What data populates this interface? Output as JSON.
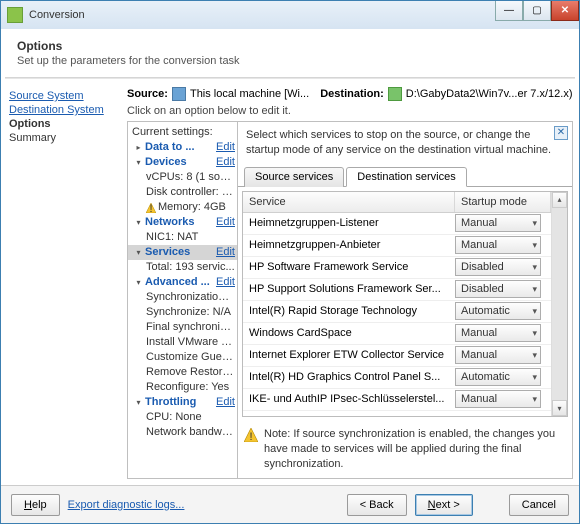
{
  "title": "Conversion",
  "header": {
    "title": "Options",
    "subtitle": "Set up the parameters for the conversion task"
  },
  "nav": {
    "source": "Source System",
    "destination": "Destination System",
    "options": "Options",
    "summary": "Summary"
  },
  "srcline": {
    "source_label": "Source:",
    "source_value": "This local machine [Wi...",
    "dest_label": "Destination:",
    "dest_value": "D:\\GabyData2\\Win7v...er 7.x/12.x)"
  },
  "clickhint": "Click on an option below to edit it.",
  "tree": {
    "title": "Current settings:",
    "edit": "Edit",
    "items": {
      "data": "Data to ...",
      "devices": "Devices",
      "vcpus": "vCPUs: 8 (1 sock...",
      "diskctrl": "Disk controller: S...",
      "memory": "Memory: 4GB",
      "networks": "Networks",
      "nic1": "NIC1: NAT",
      "services": "Services",
      "servtotal": "Total: 193 servic...",
      "advanced": "Advanced ...",
      "sync": "Synchronization: ...",
      "syncna": "Synchronize: N/A",
      "finalsync": "Final synchroniza...",
      "installvm": "Install VMware T...",
      "customize": "Customize Guest...",
      "removerestore": "Remove Restore...",
      "reconfigure": "Reconfigure: Yes",
      "throttling": "Throttling",
      "cpu": "CPU: None",
      "netbw": "Network bandwid..."
    }
  },
  "pane": {
    "instruction": "Select which services to stop on the source, or change the startup mode of any service on the destination virtual machine.",
    "tabs": {
      "src": "Source services",
      "dst": "Destination services"
    },
    "columns": {
      "service": "Service",
      "mode": "Startup mode"
    },
    "rows": [
      {
        "name": "Heimnetzgruppen-Listener",
        "mode": "Manual"
      },
      {
        "name": "Heimnetzgruppen-Anbieter",
        "mode": "Manual"
      },
      {
        "name": "HP Software Framework Service",
        "mode": "Disabled"
      },
      {
        "name": "HP Support Solutions Framework Ser...",
        "mode": "Disabled"
      },
      {
        "name": "Intel(R) Rapid Storage Technology",
        "mode": "Automatic"
      },
      {
        "name": "Windows CardSpace",
        "mode": "Manual"
      },
      {
        "name": "Internet Explorer ETW Collector Service",
        "mode": "Manual"
      },
      {
        "name": "Intel(R) HD Graphics Control Panel S...",
        "mode": "Automatic"
      },
      {
        "name": "IKE- und AuthIP IPsec-Schlüsselerstel...",
        "mode": "Manual"
      }
    ],
    "note": "Note: If source synchronization is enabled, the changes you have made to services will be applied during the final synchronization."
  },
  "footer": {
    "help": "Help",
    "export": "Export diagnostic logs...",
    "back": "< Back",
    "next": "Next >",
    "cancel": "Cancel"
  }
}
